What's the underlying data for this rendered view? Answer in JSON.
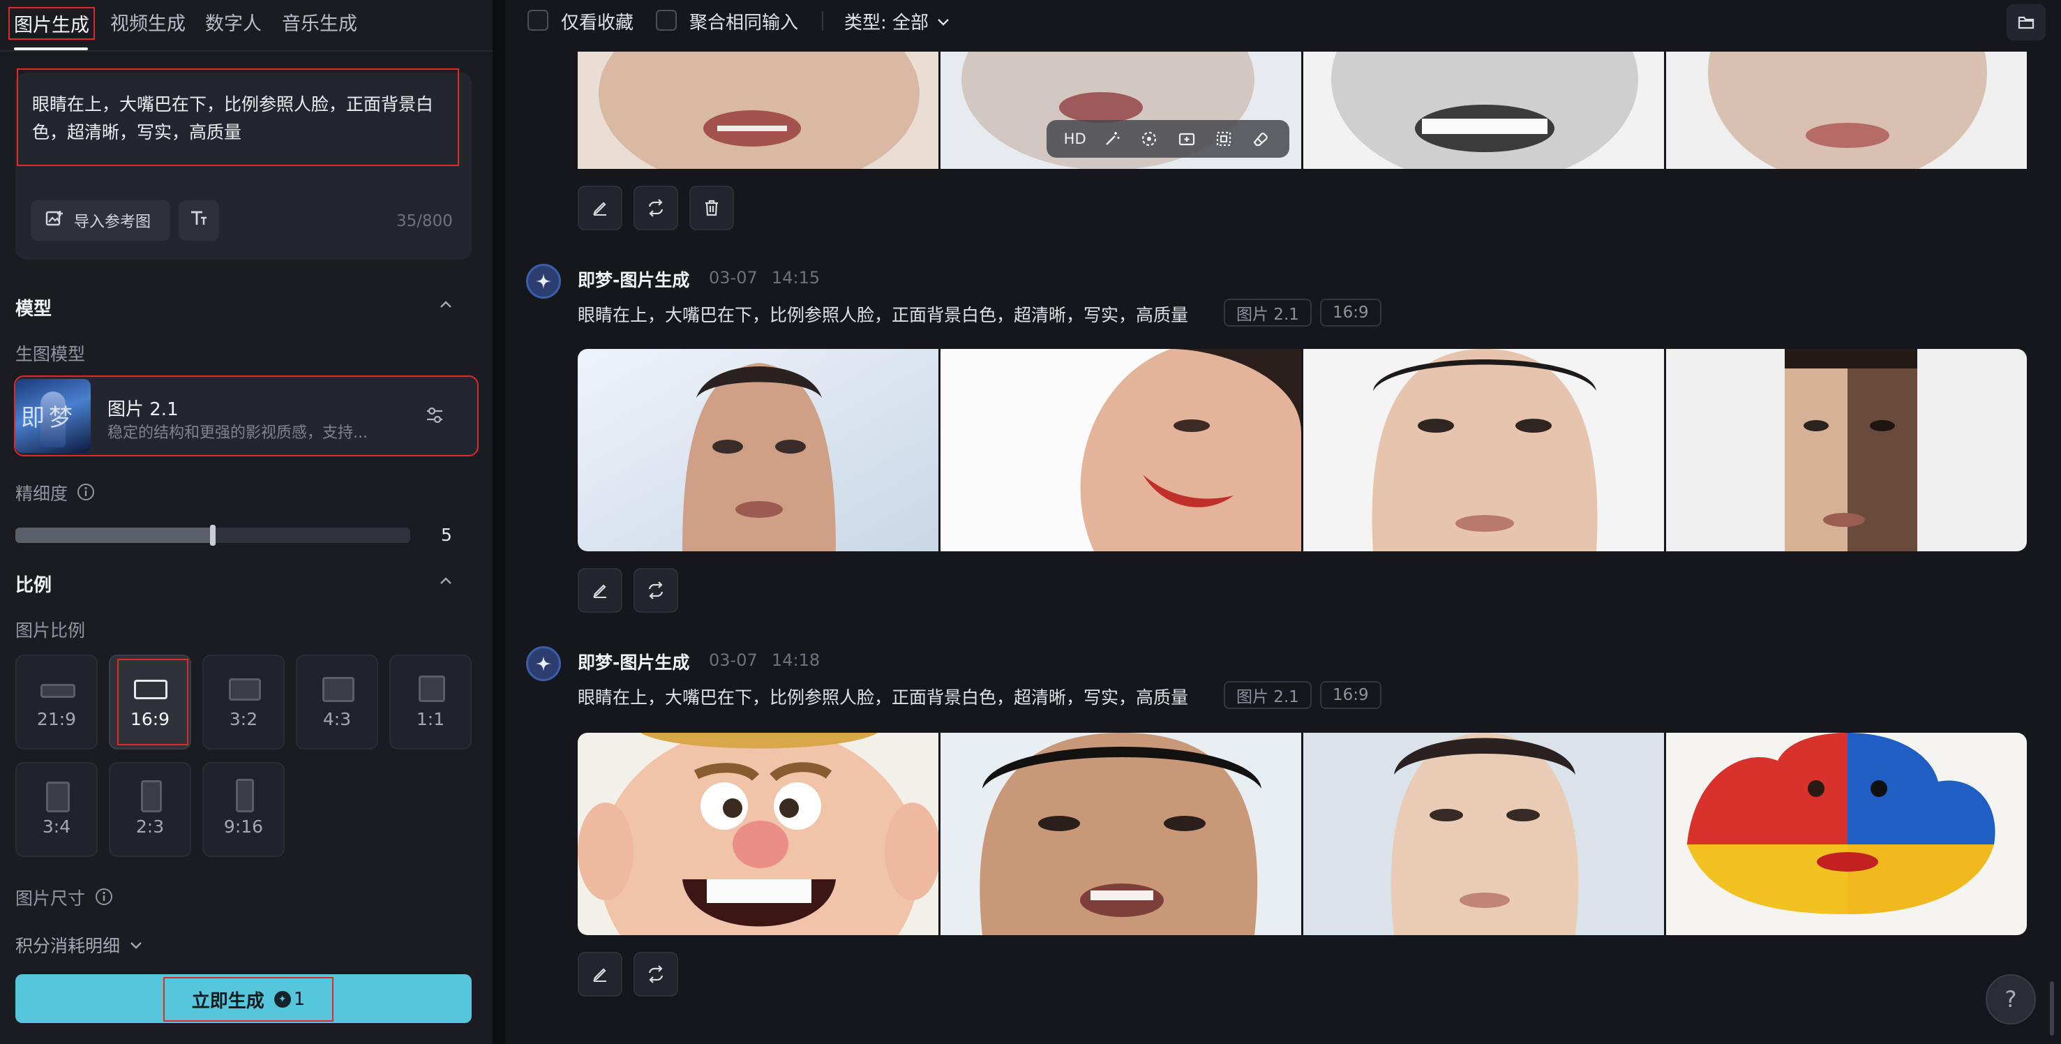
{
  "tabs": [
    {
      "label": "图片生成",
      "active": true
    },
    {
      "label": "视频生成",
      "active": false
    },
    {
      "label": "数字人",
      "active": false
    },
    {
      "label": "音乐生成",
      "active": false
    }
  ],
  "prompt": {
    "text": "眼睛在上，大嘴巴在下，比例参照人脸，正面背景白色，超清晰，写实，高质量",
    "import_ref_label": "导入参考图",
    "counter": "35/800"
  },
  "model_section": {
    "title": "模型",
    "sub_label": "生图模型",
    "model_name": "图片 2.1",
    "model_desc": "稳定的结构和更强的影视质感，支持...",
    "thumb_text": "即梦"
  },
  "detail": {
    "label": "精细度",
    "value": "5",
    "level_fraction": 0.5
  },
  "ratio_section": {
    "title": "比例",
    "sub_label": "图片比例",
    "options": [
      "21:9",
      "16:9",
      "3:2",
      "4:3",
      "1:1",
      "3:4",
      "2:3",
      "9:16"
    ],
    "selected": "16:9"
  },
  "size_label": "图片尺寸",
  "points_label": "积分消耗明细",
  "generate": {
    "label": "立即生成",
    "cost": "1"
  },
  "topbar": {
    "favorites_label": "仅看收藏",
    "merge_label": "聚合相同输入",
    "type_label": "类型: 全部"
  },
  "float_toolbar": {
    "hd_label": "HD"
  },
  "posts": [
    {
      "title": "即梦-图片生成",
      "date": "03-07",
      "time": "14:15",
      "prompt": "眼睛在上，大嘴巴在下，比例参照人脸，正面背景白色，超清晰，写实，高质量",
      "model_chip": "图片 2.1",
      "ratio_chip": "16:9"
    },
    {
      "title": "即梦-图片生成",
      "date": "03-07",
      "time": "14:18",
      "prompt": "眼睛在上，大嘴巴在下，比例参照人脸，正面背景白色，超清晰，写实，高质量",
      "model_chip": "图片 2.1",
      "ratio_chip": "16:9"
    }
  ],
  "help_label": "?",
  "colors": {
    "accent": "#55c6dc",
    "highlight_border": "#e02a2a",
    "panel": "#1a1c22",
    "canvas": "#15171c"
  }
}
